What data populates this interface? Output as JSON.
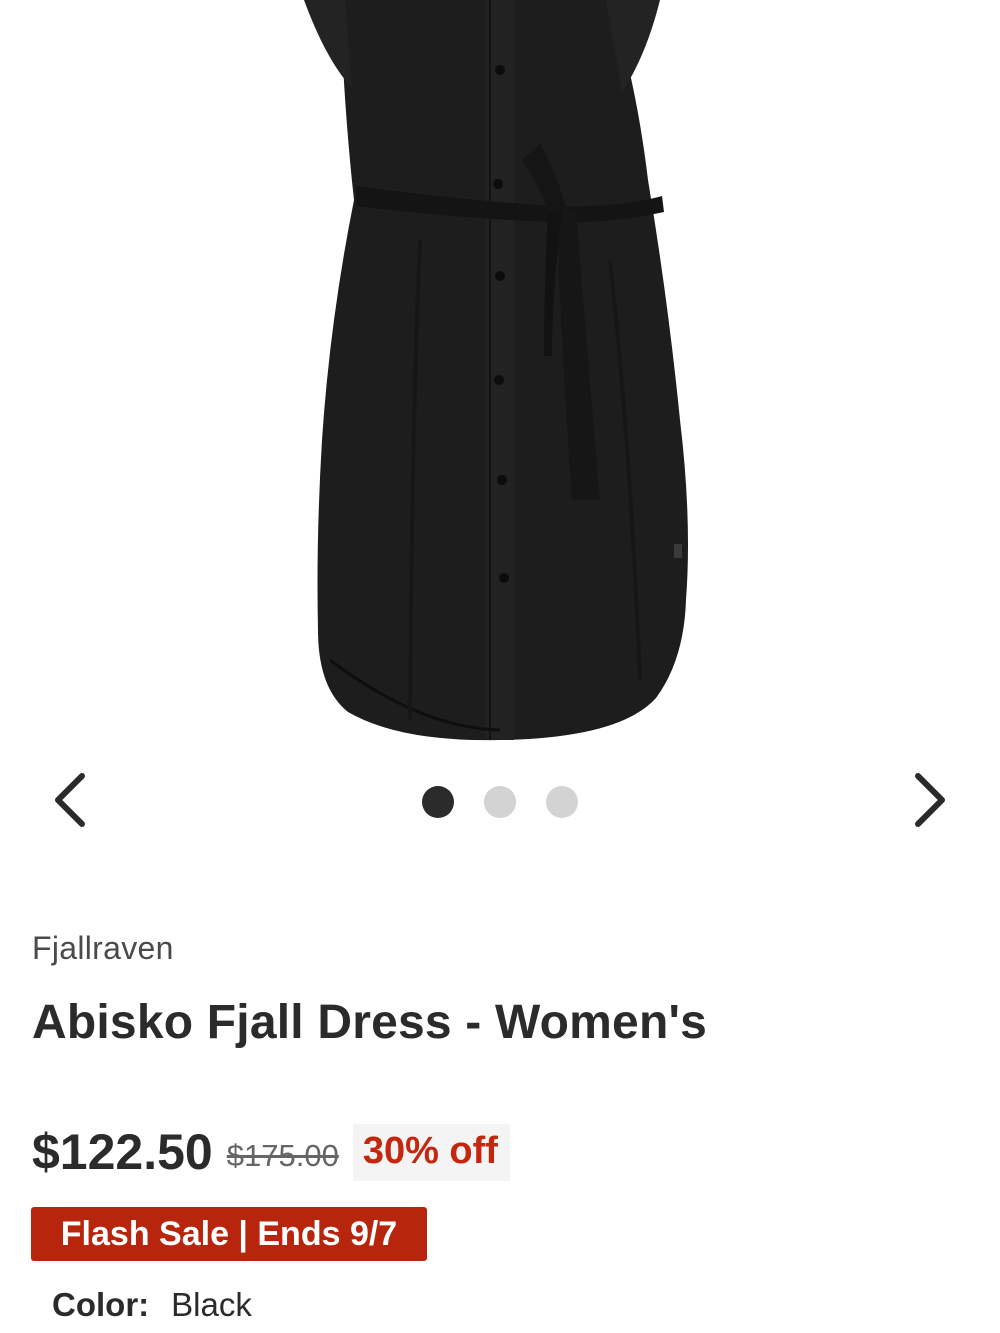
{
  "gallery": {
    "image_alt": "Black shirt dress with tie belt",
    "prev_icon": "chevron-left-icon",
    "next_icon": "chevron-right-icon",
    "slide_count": 3,
    "active_slide": 1
  },
  "product": {
    "brand": "Fjallraven",
    "title": "Abisko Fjall Dress - Women's",
    "sale_price": "$122.50",
    "original_price": "$175.00",
    "discount": "30% off",
    "promo_badge": "Flash Sale | Ends 9/7",
    "color_label": "Color:",
    "color_value": "Black"
  },
  "colors": {
    "text": "#2b2b2b",
    "sale_red": "#c4260e",
    "badge_red": "#b8250d",
    "dot_active": "#2b2b2b",
    "dot_inactive": "#d3d3d3",
    "garment": "#1d1d1d"
  }
}
